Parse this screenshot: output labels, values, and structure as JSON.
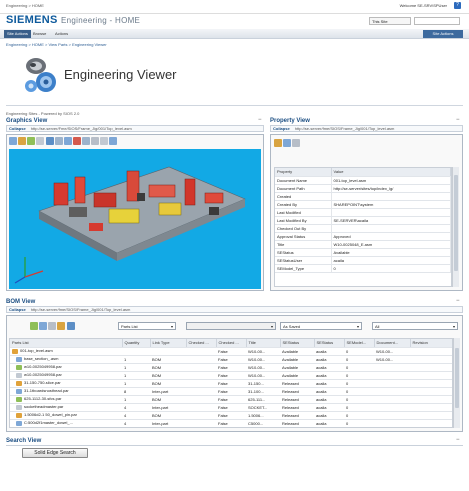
{
  "top": {
    "crumb": "Engineering > HOME",
    "welcome": "Welcome SE-SRV\\SPUser",
    "help": "?"
  },
  "brand": {
    "name": "SIEMENS",
    "app": "Engineering - HOME"
  },
  "site_select": "This Site",
  "nav": {
    "tabs": [
      "Site Actions",
      "Browse",
      "Actions"
    ],
    "site_actions": "Site Actions"
  },
  "breadcrumb": "Engineering > HOME > View Parts > Engineering Viewer",
  "page_title": "Engineering Viewer",
  "powered_by": "Engineering Sites - Powered by SIOS 2.0",
  "graphics": {
    "title": "Graphics View",
    "collapse": "Collapse",
    "url": "http://se-server/Fme/SIOS/Frame_Jig/001/Top_level.asm"
  },
  "property": {
    "title": "Property View",
    "collapse": "Collapse",
    "url": "http://se-server/fme/SIOS/Frame_Jig/001/Top_level.asm",
    "headers": [
      "Property",
      "Value"
    ],
    "rows": [
      [
        "Document Name",
        "001-top_level.asm"
      ],
      [
        "Document Path",
        "http://se-server/sites/top/index_lg/"
      ],
      [
        "Created",
        ""
      ],
      [
        "Created By",
        "SHAREPOINT\\system"
      ],
      [
        "Last Modified",
        ""
      ],
      [
        "Last Modified By",
        "SE-SERVER\\acaila"
      ],
      [
        "Checked Out By",
        ""
      ],
      [
        "Approval Status",
        "Approved"
      ],
      [
        "Title",
        "W10-0025048_E.asm"
      ],
      [
        "SEStatus",
        "Available"
      ],
      [
        "SEStatusUser",
        "acaila"
      ],
      [
        "SEModel_Type",
        "0"
      ]
    ]
  },
  "bom": {
    "title": "BOM View",
    "collapse": "Collapse",
    "url": "http://se-server/fme/SIOS/Frame_Jig/001/Top_level.asm",
    "list_select": "Parts List",
    "saved_select": "As Saved",
    "all_select": "All",
    "headers": [
      "Parts List",
      "Quantity",
      "Link Type",
      "Checked ...",
      "Checked ...",
      "Title",
      "SEStatus",
      "SEStatus",
      "SEModel...",
      "Document...",
      "Revision"
    ],
    "rows": [
      [
        "001-top_level.asm",
        "",
        "",
        "",
        "False",
        "W10-00...",
        "Available",
        "acaila",
        "0",
        "W10-00...",
        ""
      ],
      [
        "base_section_.asm",
        "1",
        "BOM",
        "",
        "False",
        "W10-00...",
        "Available",
        "acaila",
        "0",
        "W10-00...",
        ""
      ],
      [
        "w10-0025049958.par",
        "1",
        "BOM",
        "",
        "False",
        "W10-00...",
        "Available",
        "acaila",
        "0",
        "",
        ""
      ],
      [
        "w10-0025049958.par",
        "1",
        "BOM",
        "",
        "False",
        "W10-00...",
        "Available",
        "acaila",
        "0",
        "",
        ""
      ],
      [
        "31-150-750-slice.par",
        "1",
        "BOM",
        "",
        "False",
        "31-150...",
        "Released",
        "acaila",
        "0",
        "",
        ""
      ],
      [
        "31-1tboardsnosthead.par",
        "8",
        "Inter-part",
        "",
        "False",
        "31-100...",
        "Released",
        "acaila",
        "0",
        "",
        ""
      ],
      [
        "625-1112-30-sfcs.par",
        "1",
        "BOM",
        "",
        "False",
        "625-111...",
        "Released",
        "acaila",
        "0",
        "",
        ""
      ],
      [
        "socketheadmaster.par",
        "4",
        "Inter-part",
        "",
        "False",
        "SOCKET...",
        "Released",
        "acaila",
        "0",
        "",
        ""
      ],
      [
        "1.5006d2-1 50_dowel_pin.par",
        "4",
        "BOM",
        "",
        "False",
        "1.5006...",
        "Released",
        "acaila",
        "0",
        "",
        ""
      ],
      [
        "C:500d2f1master_dowel_...",
        "4",
        "Inter-part",
        "",
        "False",
        "C5000...",
        "Released",
        "acaila",
        "0",
        "",
        ""
      ]
    ]
  },
  "search": {
    "title": "Search View",
    "button": "Solid Edge Search"
  },
  "colors": {
    "accent": "#1a4d82",
    "viewport": "#12a9e5",
    "brand": "#0e5a9c"
  }
}
